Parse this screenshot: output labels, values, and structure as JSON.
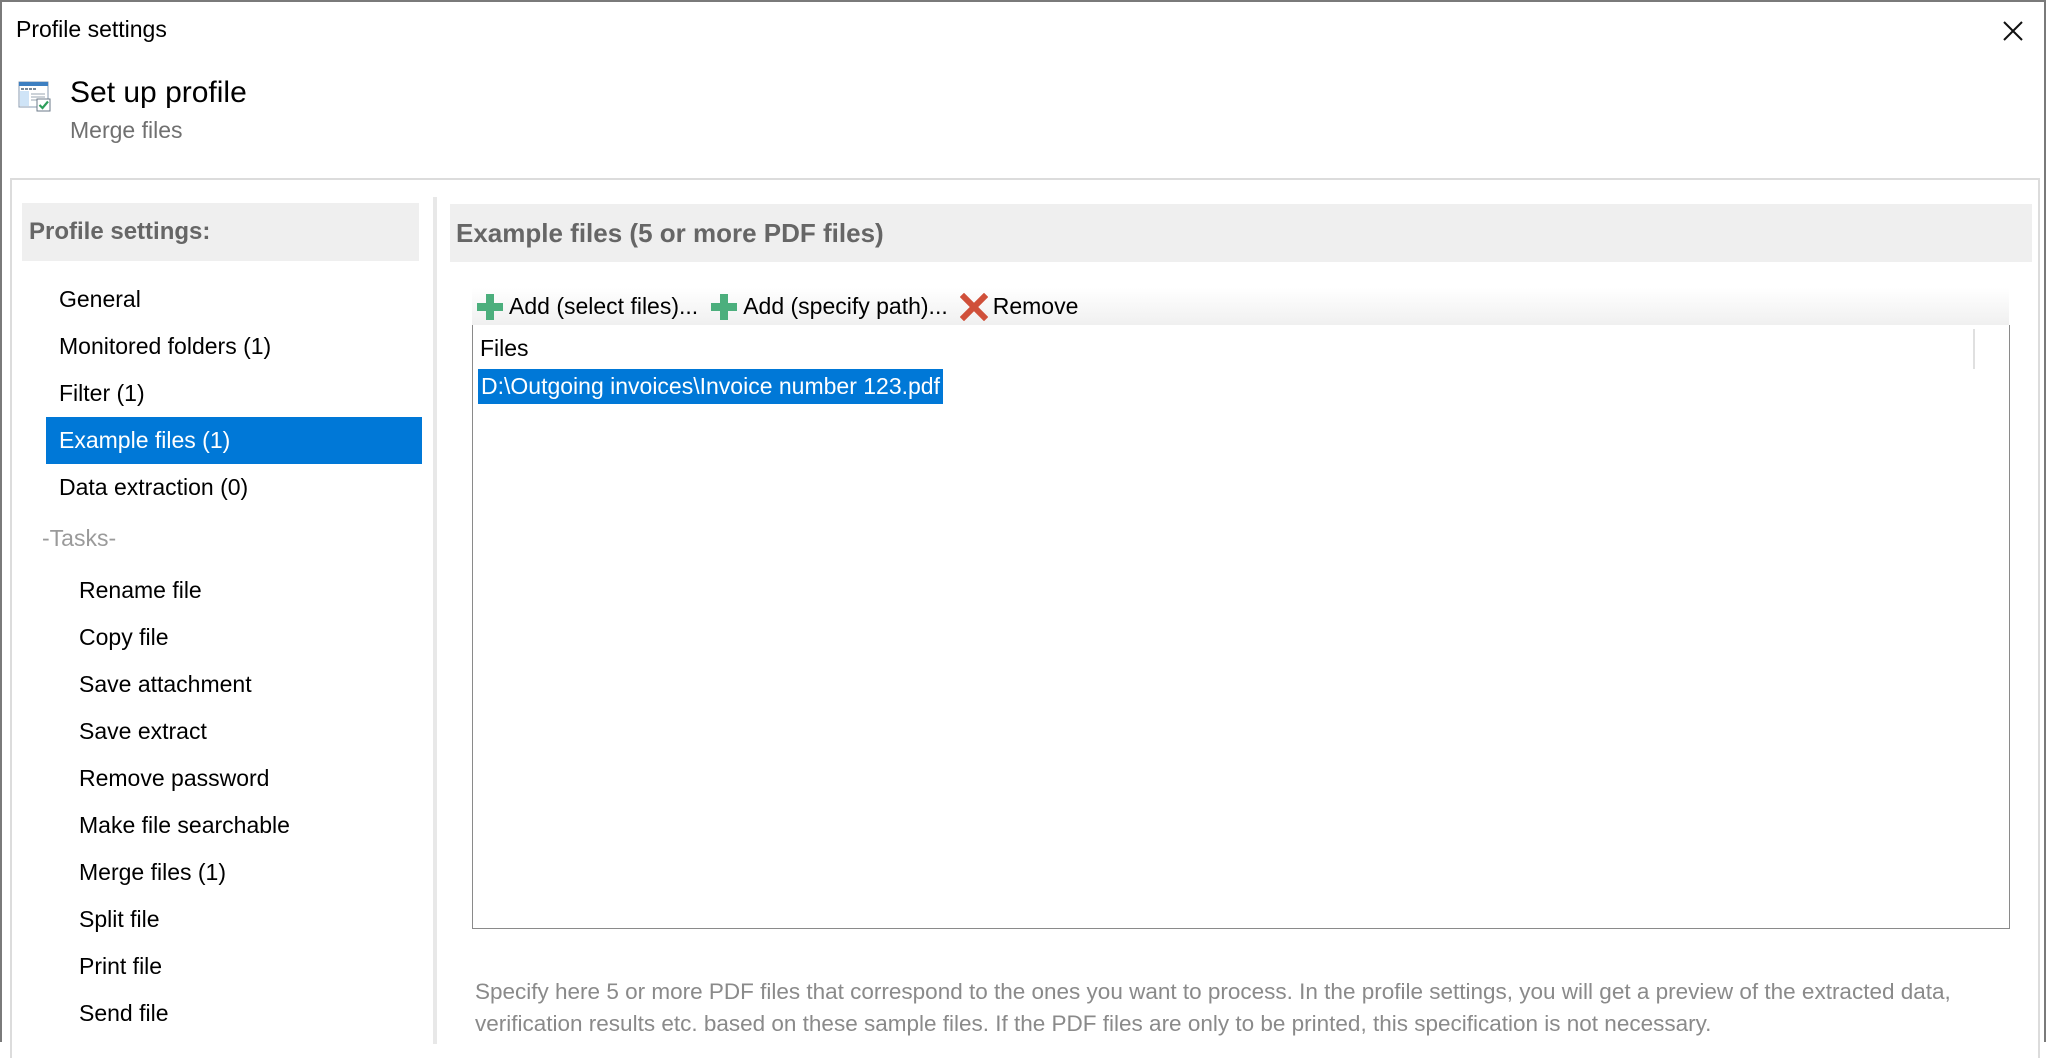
{
  "window": {
    "title": "Profile settings",
    "close_icon": "close-icon"
  },
  "header": {
    "icon": "profile-window-check-icon",
    "title": "Set up profile",
    "subtitle": "Merge files"
  },
  "sidebar": {
    "heading": "Profile settings:",
    "items": [
      {
        "label": "General",
        "selected": false
      },
      {
        "label": "Monitored folders (1)",
        "selected": false
      },
      {
        "label": "Filter (1)",
        "selected": false
      },
      {
        "label": "Example files (1)",
        "selected": true
      },
      {
        "label": "Data extraction (0)",
        "selected": false
      }
    ],
    "group_label": "-Tasks-",
    "tasks": [
      {
        "label": "Rename file"
      },
      {
        "label": "Copy file"
      },
      {
        "label": "Save attachment"
      },
      {
        "label": "Save extract"
      },
      {
        "label": "Remove password"
      },
      {
        "label": "Make file searchable"
      },
      {
        "label": "Merge files (1)"
      },
      {
        "label": "Split file"
      },
      {
        "label": "Print file"
      },
      {
        "label": "Send file"
      }
    ]
  },
  "main": {
    "heading": "Example files (5 or more PDF files)",
    "toolbar": {
      "add_select_label": "Add (select files)...",
      "add_path_label": "Add (specify path)...",
      "remove_label": "Remove"
    },
    "list": {
      "column_header": "Files",
      "rows": [
        {
          "path": "D:\\Outgoing invoices\\Invoice number 123.pdf",
          "selected": true
        }
      ]
    },
    "description": "Specify here 5 or more PDF files that correspond to the ones you want to process. In the profile settings, you will get a preview of the extracted data, verification results etc. based on these sample files. If the PDF files are only to be printed, this specification is not necessary."
  },
  "colors": {
    "accent": "#0078d7",
    "add_icon": "#4caf7d",
    "remove_icon": "#d0503a",
    "section_header_bg": "#efefef"
  }
}
